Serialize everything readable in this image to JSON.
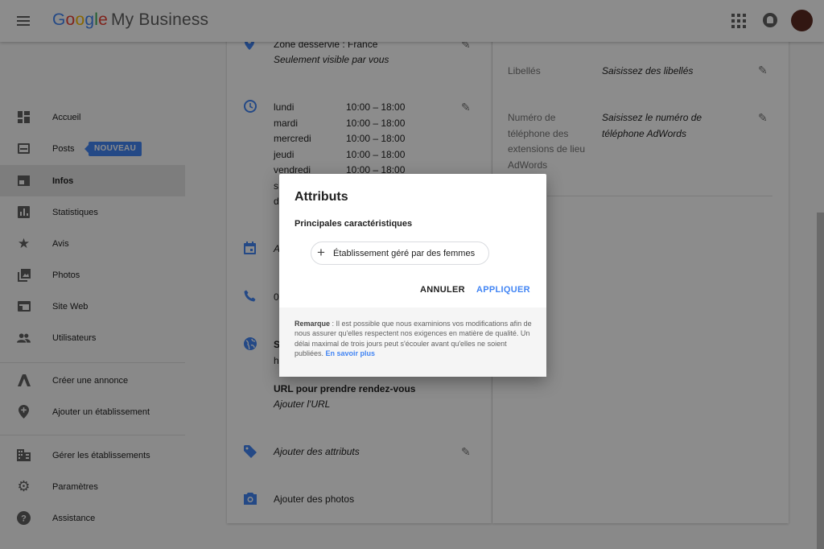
{
  "header": {
    "logo_text": "Google",
    "product": "My Business"
  },
  "sidebar": {
    "items": [
      {
        "label": "Accueil",
        "icon": "dashboard-icon"
      },
      {
        "label": "Posts",
        "icon": "posts-icon",
        "badge": "NOUVEAU"
      },
      {
        "label": "Infos",
        "icon": "store-icon",
        "active": true
      },
      {
        "label": "Statistiques",
        "icon": "bar-chart-icon"
      },
      {
        "label": "Avis",
        "icon": "star-icon"
      },
      {
        "label": "Photos",
        "icon": "photo-library-icon"
      },
      {
        "label": "Site Web",
        "icon": "web-icon"
      },
      {
        "label": "Utilisateurs",
        "icon": "people-icon"
      },
      {
        "label": "Créer une annonce",
        "icon": "adwords-icon"
      },
      {
        "label": "Ajouter un établissement",
        "icon": "add-location-icon"
      },
      {
        "label": "Gérer les établissements",
        "icon": "business-icon"
      },
      {
        "label": "Paramètres",
        "icon": "gear-icon"
      },
      {
        "label": "Assistance",
        "icon": "help-icon"
      }
    ]
  },
  "info": {
    "zone_label": "Zone desservie : France",
    "zone_note": "Seulement visible par vous",
    "hours": [
      {
        "day": "lundi",
        "time": "10:00 – 18:00"
      },
      {
        "day": "mardi",
        "time": "10:00 – 18:00"
      },
      {
        "day": "mercredi",
        "time": "10:00 – 18:00"
      },
      {
        "day": "jeudi",
        "time": "10:00 – 18:00"
      },
      {
        "day": "vendredi",
        "time": "10:00 – 18:00"
      },
      {
        "day": "s",
        "time": ""
      },
      {
        "day": "d",
        "time": ""
      }
    ],
    "date_stub": "A",
    "phone_stub": "0",
    "site_stub": "S",
    "site_sub_stub": "h",
    "booking_title": "URL pour prendre rendez-vous",
    "booking_add": "Ajouter l'URL",
    "attributes_add": "Ajouter des attributs",
    "photos_add": "Ajouter des photos"
  },
  "side": {
    "labels_title": "Libellés",
    "labels_value": "Saisissez des libellés",
    "phone_title": "Numéro de téléphone des extensions de lieu AdWords",
    "phone_title_lines": [
      "Numéro de",
      "téléphone des",
      "extensions de lieu",
      "AdWords"
    ],
    "phone_value_lines": [
      "Saisissez le numéro de",
      "téléphone AdWords"
    ]
  },
  "dialog": {
    "title": "Attributs",
    "subtitle": "Principales caractéristiques",
    "chip_label": "Établissement géré par des femmes",
    "cancel": "ANNULER",
    "apply": "APPLIQUER",
    "note_label": "Remarque",
    "note_text": " : Il est possible que nous examinions vos modifications afin de nous assurer qu'elles respectent nos exigences en matière de qualité. Un délai maximal de trois jours peut s'écouler avant qu'elles ne soient publiées. ",
    "note_link": "En savoir plus"
  },
  "colors": {
    "accent": "#4285f4",
    "active_bg": "#e3e3e3"
  }
}
